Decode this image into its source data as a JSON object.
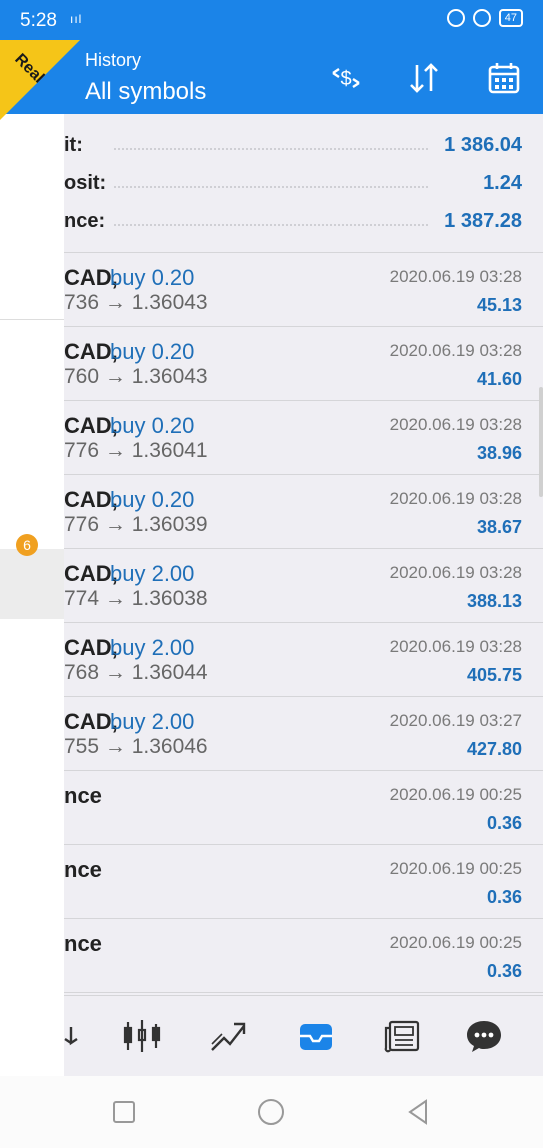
{
  "status_bar": {
    "time": "5:28",
    "signal": "ııl",
    "battery": "47"
  },
  "header": {
    "subtitle": "History",
    "title": "All symbols"
  },
  "account_tag": "Real",
  "drawer_badge": "6",
  "summary": [
    {
      "label": "it:",
      "value": "1 386.04"
    },
    {
      "label": "osit:",
      "value": "1.24"
    },
    {
      "label": "nce:",
      "value": "1 387.28"
    }
  ],
  "deals": [
    {
      "symbol": "CAD,",
      "side": "buy 0.20",
      "prices": "736 → 1.36043",
      "time": "2020.06.19 03:28",
      "profit": "45.13"
    },
    {
      "symbol": "CAD,",
      "side": "buy 0.20",
      "prices": "760 → 1.36043",
      "time": "2020.06.19 03:28",
      "profit": "41.60"
    },
    {
      "symbol": "CAD,",
      "side": "buy 0.20",
      "prices": "776 → 1.36041",
      "time": "2020.06.19 03:28",
      "profit": "38.96"
    },
    {
      "symbol": "CAD,",
      "side": "buy 0.20",
      "prices": "776 → 1.36039",
      "time": "2020.06.19 03:28",
      "profit": "38.67"
    },
    {
      "symbol": "CAD,",
      "side": "buy 2.00",
      "prices": "774 → 1.36038",
      "time": "2020.06.19 03:28",
      "profit": "388.13"
    },
    {
      "symbol": "CAD,",
      "side": "buy 2.00",
      "prices": "768 → 1.36044",
      "time": "2020.06.19 03:28",
      "profit": "405.75"
    },
    {
      "symbol": "CAD,",
      "side": "buy 2.00",
      "prices": "755 → 1.36046",
      "time": "2020.06.19 03:27",
      "profit": "427.80"
    },
    {
      "symbol": "nce",
      "side": "",
      "prices": "",
      "time": "2020.06.19 00:25",
      "profit": "0.36"
    },
    {
      "symbol": "nce",
      "side": "",
      "prices": "",
      "time": "2020.06.19 00:25",
      "profit": "0.36"
    },
    {
      "symbol": "nce",
      "side": "",
      "prices": "",
      "time": "2020.06.19 00:25",
      "profit": "0.36"
    }
  ],
  "colors": {
    "accent": "#1b84e8",
    "value_blue": "#1f6fb8",
    "badge": "#f0a020",
    "tag": "#f5c518"
  }
}
